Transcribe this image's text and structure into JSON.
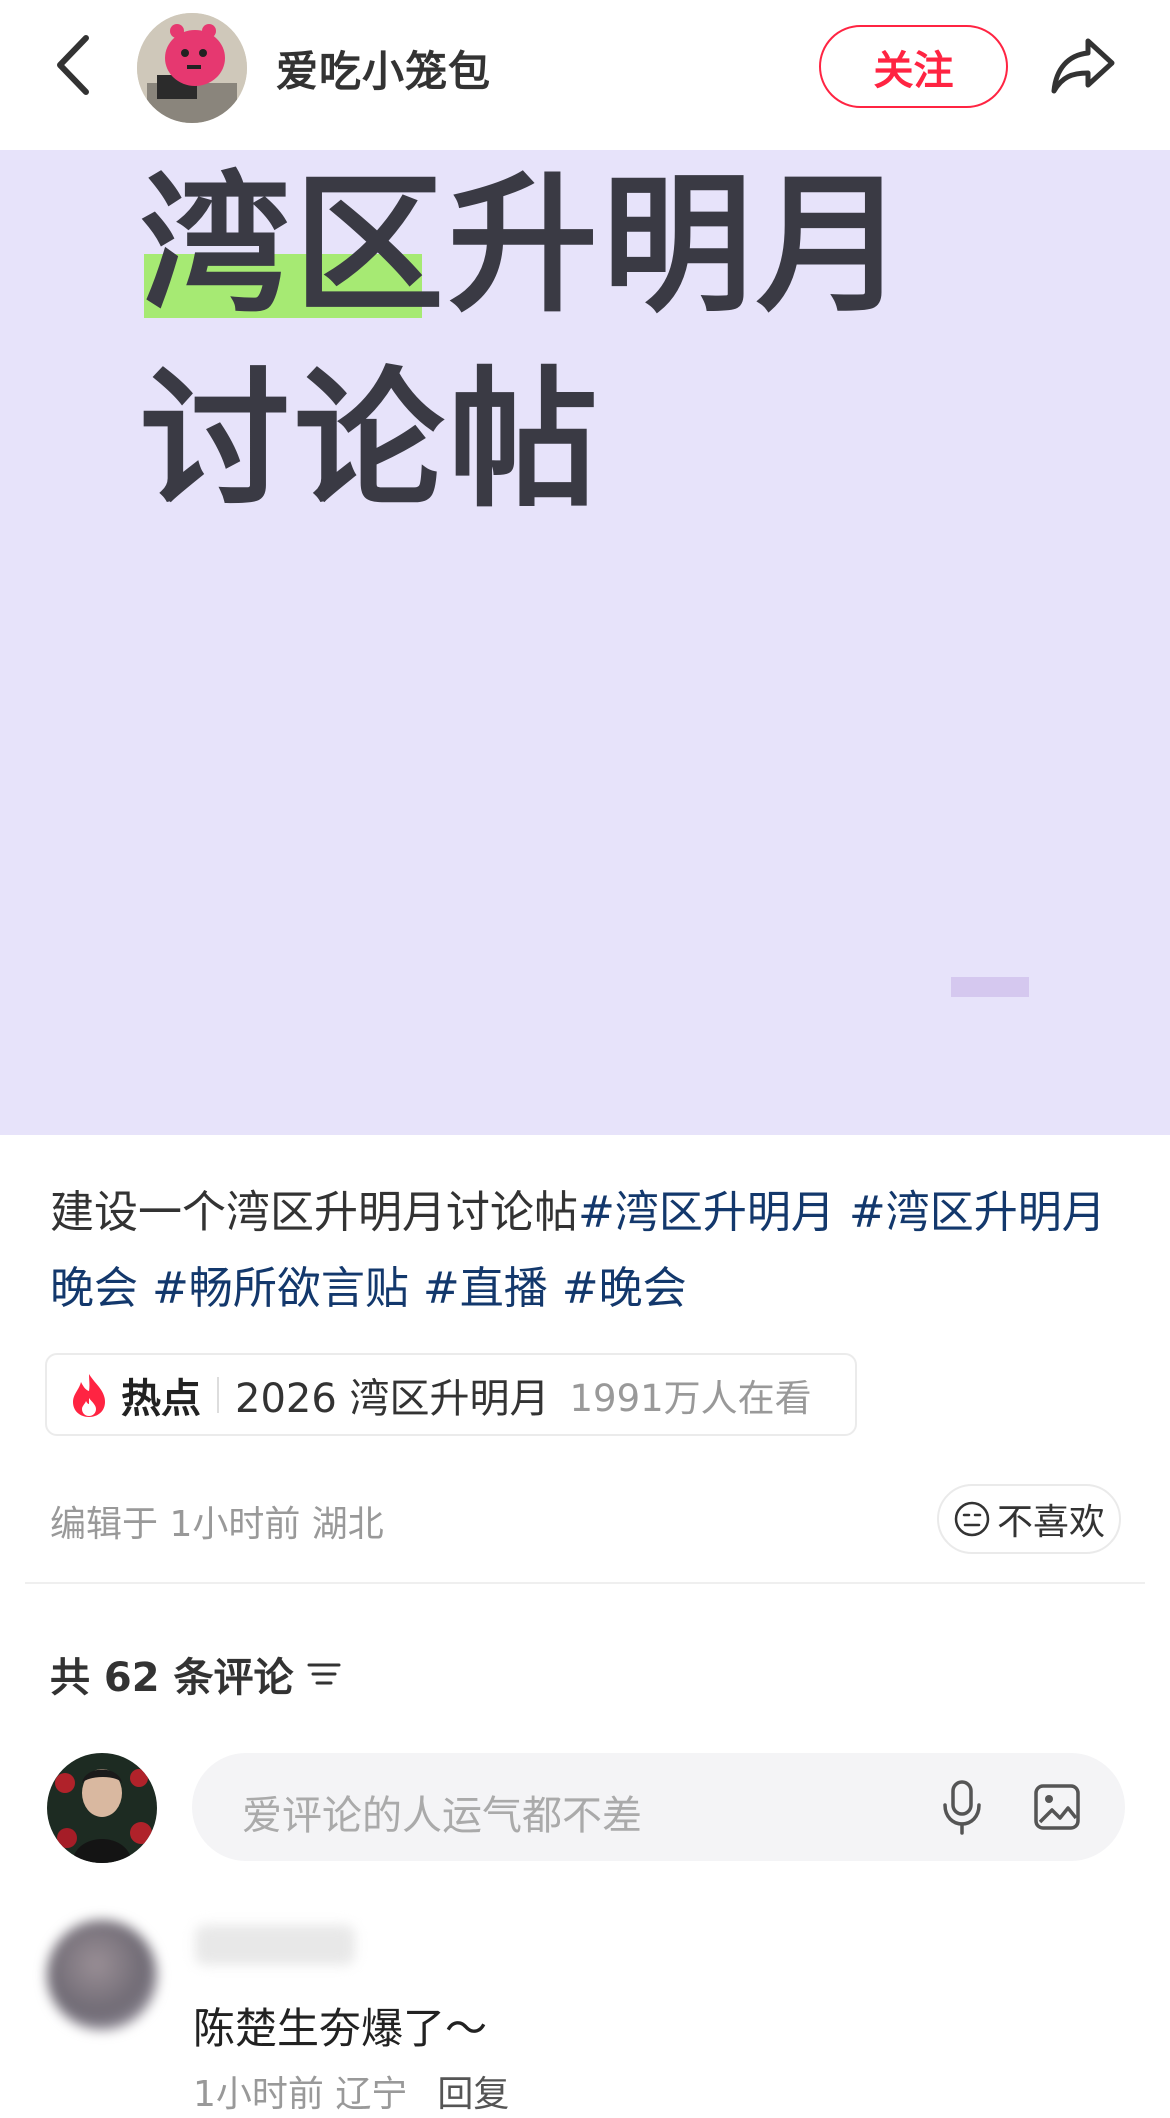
{
  "header": {
    "author_name": "爱吃小笼包",
    "follow_label": "关注",
    "icons": {
      "back": "chevron-left-icon",
      "share": "share-arrow-icon"
    }
  },
  "cover": {
    "line1": "湾区升明月",
    "line2": "讨论帖",
    "background": "#e7e3fa",
    "highlight_color": "#a6ea73"
  },
  "post": {
    "text": "建设一个湾区升明月讨论帖",
    "tags": [
      "#湾区升明月",
      "#湾区升明月晚会",
      "#畅所欲言贴",
      "#直播",
      "#晚会"
    ]
  },
  "hot": {
    "label": "热点",
    "topic": "2026 湾区升明月",
    "count": "1991万人在看"
  },
  "meta": {
    "edited": "编辑于 1小时前 湖北",
    "dislike_label": "不喜欢"
  },
  "comments": {
    "count_label": "共 62 条评论",
    "input_placeholder": "爱评论的人运气都不差",
    "items": [
      {
        "text": "陈楚生夯爆了～",
        "time_location": "1小时前 辽宁",
        "reply_label": "回复"
      }
    ]
  },
  "colors": {
    "accent": "#ff2442",
    "tag": "#13386c"
  }
}
